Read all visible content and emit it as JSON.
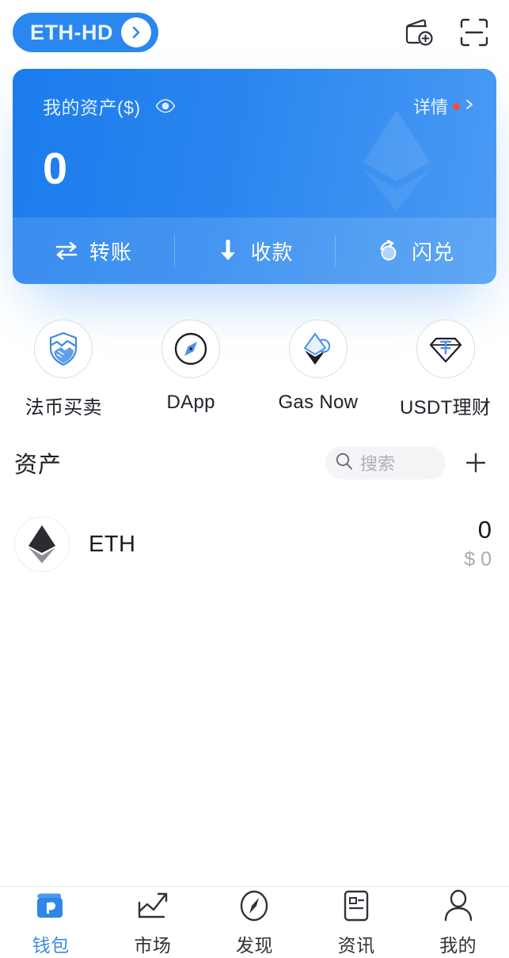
{
  "header": {
    "wallet_name": "ETH-HD",
    "chevron_icon": "chevron-right-icon",
    "add_wallet_icon": "add-wallet-icon",
    "scan_icon": "scan-qr-icon"
  },
  "balance_card": {
    "label": "我的资产($)",
    "eye_icon": "eye-visibility-icon",
    "amount": "0",
    "detail_label": "详情",
    "detail_badge": "red-dot",
    "detail_chevron_icon": "chevron-right-icon",
    "watermark_icon": "ethereum-diamond-icon",
    "actions": [
      {
        "label": "转账",
        "icon": "transfer-arrows-icon"
      },
      {
        "label": "收款",
        "icon": "receive-arrow-down-icon"
      },
      {
        "label": "闪兑",
        "icon": "swap-refresh-icon"
      }
    ]
  },
  "features": [
    {
      "label": "法币买卖",
      "icon": "shield-handshake-icon"
    },
    {
      "label": "DApp",
      "icon": "compass-icon"
    },
    {
      "label": "Gas Now",
      "icon": "ethereum-gas-icon"
    },
    {
      "label": "USDT理财",
      "icon": "diamond-yuan-icon"
    }
  ],
  "assets": {
    "title": "资产",
    "search": {
      "placeholder": "搜索",
      "value": "",
      "icon": "search-icon"
    },
    "add_icon": "plus-icon",
    "rows": [
      {
        "symbol": "ETH",
        "amount": "0",
        "fiat": "$ 0",
        "icon": "ethereum-coin-icon"
      }
    ]
  },
  "bottom_nav": {
    "active_index": 0,
    "items": [
      {
        "label": "钱包",
        "icon": "wallet-icon"
      },
      {
        "label": "市场",
        "icon": "market-chart-icon"
      },
      {
        "label": "发现",
        "icon": "compass-icon"
      },
      {
        "label": "资讯",
        "icon": "news-document-icon"
      },
      {
        "label": "我的",
        "icon": "person-icon"
      }
    ]
  },
  "colors": {
    "brand_blue": "#2a87ef",
    "card_blue_start": "#1c7ced",
    "card_blue_end": "#4a9bf4",
    "accent_red": "#f9453e",
    "nav_active": "#3a8ae8",
    "icon_blue": "#3e8ae0"
  }
}
